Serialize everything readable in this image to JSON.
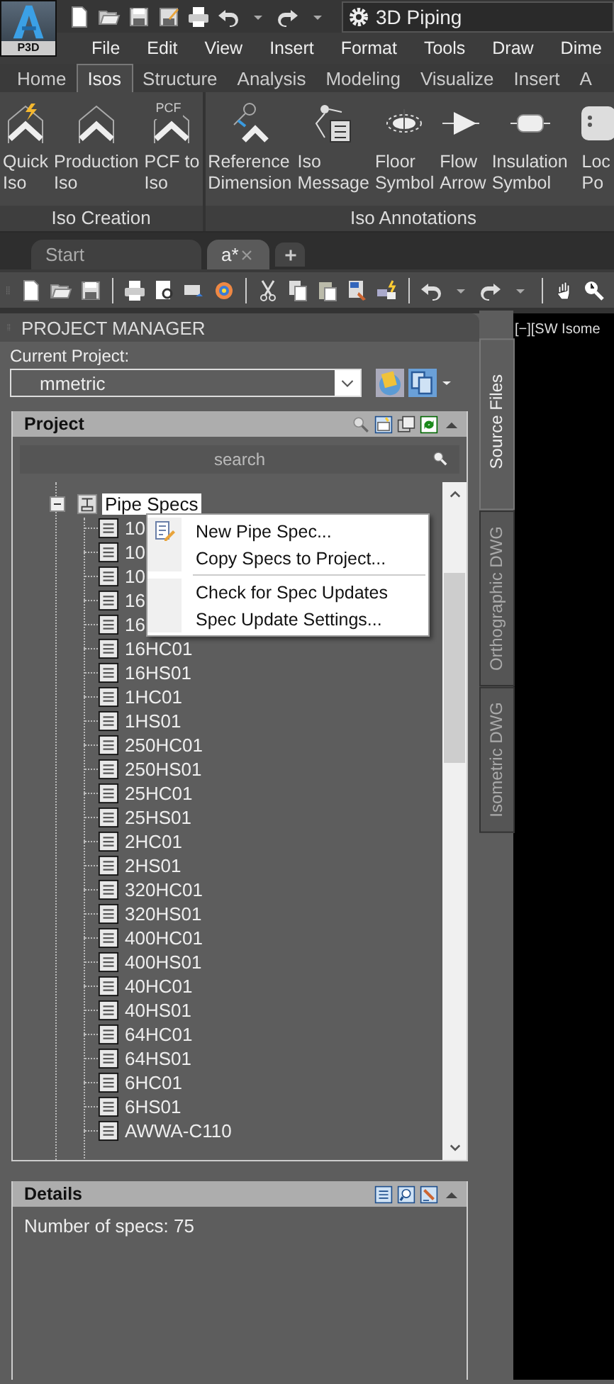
{
  "app_button": {
    "label": "P3D"
  },
  "quick_access": {
    "workspace": "3D Piping"
  },
  "menu_bar": [
    "File",
    "Edit",
    "View",
    "Insert",
    "Format",
    "Tools",
    "Draw",
    "Dime"
  ],
  "ribbon_tabs": [
    {
      "label": "Home",
      "selected": false
    },
    {
      "label": "Isos",
      "selected": true
    },
    {
      "label": "Structure",
      "selected": false
    },
    {
      "label": "Analysis",
      "selected": false
    },
    {
      "label": "Modeling",
      "selected": false
    },
    {
      "label": "Visualize",
      "selected": false
    },
    {
      "label": "Insert",
      "selected": false
    },
    {
      "label": "A",
      "selected": false
    }
  ],
  "ribbon_groups": [
    {
      "title": "Iso Creation",
      "tools": [
        {
          "lines": [
            "Quick",
            "Iso"
          ]
        },
        {
          "lines": [
            "Production",
            "Iso"
          ]
        },
        {
          "lines": [
            "PCF to",
            "Iso"
          ],
          "icon_text": "PCF"
        }
      ]
    },
    {
      "title": "Iso Annotations",
      "tools": [
        {
          "lines": [
            "Reference",
            "Dimension"
          ]
        },
        {
          "lines": [
            "Iso",
            "Message"
          ]
        },
        {
          "lines": [
            "Floor",
            "Symbol"
          ]
        },
        {
          "lines": [
            "Flow",
            "Arrow"
          ]
        },
        {
          "lines": [
            "Insulation",
            "Symbol"
          ]
        },
        {
          "lines": [
            "Loc",
            "Po"
          ]
        }
      ]
    }
  ],
  "document_tabs": [
    {
      "label": "Start",
      "selected": false
    },
    {
      "label": "a*",
      "selected": true
    }
  ],
  "project_manager": {
    "title": "PROJECT MANAGER",
    "current_project_label": "Current Project:",
    "current_project": "mmetric",
    "project_panel": {
      "title": "Project",
      "search_placeholder": "search",
      "tree": {
        "label": "Pipe Specs",
        "expanded": true,
        "selected": true,
        "children": [
          {
            "label": "10",
            "selected": false
          },
          {
            "label": "10",
            "selected": false
          },
          {
            "label": "10",
            "selected": false
          },
          {
            "label": "16",
            "selected": false
          },
          {
            "label": "16",
            "selected": false
          },
          {
            "label": "16HC01",
            "selected": false
          },
          {
            "label": "16HS01",
            "selected": false
          },
          {
            "label": "1HC01",
            "selected": false
          },
          {
            "label": "1HS01",
            "selected": false
          },
          {
            "label": "250HC01",
            "selected": false
          },
          {
            "label": "250HS01",
            "selected": false
          },
          {
            "label": "25HC01",
            "selected": false
          },
          {
            "label": "25HS01",
            "selected": false
          },
          {
            "label": "2HC01",
            "selected": false
          },
          {
            "label": "2HS01",
            "selected": false
          },
          {
            "label": "320HC01",
            "selected": false
          },
          {
            "label": "320HS01",
            "selected": false
          },
          {
            "label": "400HC01",
            "selected": false
          },
          {
            "label": "400HS01",
            "selected": false
          },
          {
            "label": "40HC01",
            "selected": false
          },
          {
            "label": "40HS01",
            "selected": false
          },
          {
            "label": "64HC01",
            "selected": false
          },
          {
            "label": "64HS01",
            "selected": false
          },
          {
            "label": "6HC01",
            "selected": false
          },
          {
            "label": "6HS01",
            "selected": false
          },
          {
            "label": "AWWA-C110",
            "selected": false
          }
        ]
      }
    },
    "details": {
      "title": "Details",
      "text": "Number of specs: 75"
    }
  },
  "context_menu": [
    {
      "kind": "item",
      "label": "New Pipe Spec...",
      "has_icon": true
    },
    {
      "kind": "item",
      "label": "Copy Specs to Project...",
      "has_icon": false
    },
    {
      "kind": "separator"
    },
    {
      "kind": "item",
      "label": "Check for Spec Updates",
      "has_icon": false
    },
    {
      "kind": "item",
      "label": "Spec Update Settings...",
      "has_icon": false
    }
  ],
  "side_tabs": [
    {
      "label": "Source Files",
      "selected": true
    },
    {
      "label": "Orthographic DWG",
      "selected": false
    },
    {
      "label": "Isometric DWG",
      "selected": false
    }
  ],
  "viewport": {
    "label": "[−][SW Isome"
  }
}
